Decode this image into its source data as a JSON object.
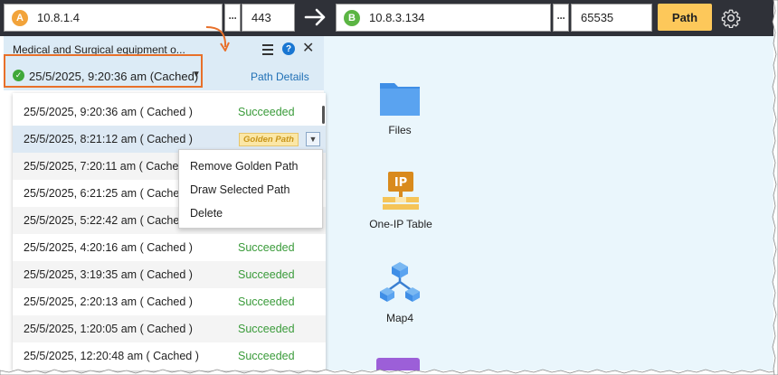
{
  "topbar": {
    "source": {
      "badge": "A",
      "ip": "10.8.1.4",
      "port": "443",
      "more": "···"
    },
    "destination": {
      "badge": "B",
      "ip": "10.8.3.134",
      "port": "65535",
      "more": "···"
    },
    "path_button": "Path"
  },
  "panel": {
    "title": "Medical and Surgical equipment o...",
    "selected": "25/5/2025, 9:20:36 am (Cached)",
    "path_details": "Path Details"
  },
  "history": [
    {
      "time": "25/5/2025, 9:20:36 am ( Cached )",
      "status": "Succeeded"
    },
    {
      "time": "25/5/2025, 8:21:12 am ( Cached )",
      "status": "",
      "tag": "Golden Path"
    },
    {
      "time": "25/5/2025, 7:20:11 am ( Cached )",
      "status": ""
    },
    {
      "time": "25/5/2025, 6:21:25 am ( Cached )",
      "status": ""
    },
    {
      "time": "25/5/2025, 5:22:42 am ( Cached )",
      "status": ""
    },
    {
      "time": "25/5/2025, 4:20:16 am ( Cached )",
      "status": "Succeeded"
    },
    {
      "time": "25/5/2025, 3:19:35 am ( Cached )",
      "status": "Succeeded"
    },
    {
      "time": "25/5/2025, 2:20:13 am ( Cached )",
      "status": "Succeeded"
    },
    {
      "time": "25/5/2025, 1:20:05 am ( Cached )",
      "status": "Succeeded"
    },
    {
      "time": "25/5/2025, 12:20:48 am ( Cached )",
      "status": "Succeeded"
    }
  ],
  "context_menu": [
    "Remove Golden Path",
    "Draw Selected Path",
    "Delete"
  ],
  "tools": {
    "files": "Files",
    "oneip": "One-IP Table",
    "oneip_badge": "IP",
    "map": "Map4"
  },
  "colors": {
    "accent": "#fdc85a",
    "success": "#3a9b3a",
    "highlight": "#e8702a",
    "topbar": "#2f3138"
  }
}
